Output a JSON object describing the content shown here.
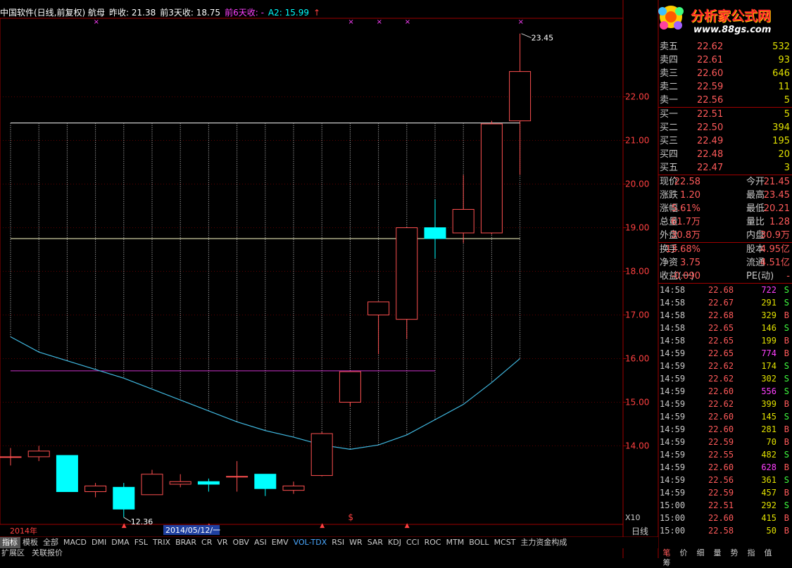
{
  "header": {
    "stock_name": "中国软件(日线,前复权) 航母",
    "prev_close": "昨收: 21.38",
    "prev3_close": "前3天收: 18.75",
    "prev6_close": "前6天收: -",
    "a2": "A2: 15.99",
    "colors": {
      "title": "#ffffff",
      "magenta": "#ff40ff",
      "cyan": "#00ffff"
    }
  },
  "logo": {
    "main": "分析家公式网",
    "url": "www.88gs.com"
  },
  "chart_data": {
    "type": "candlestick",
    "ylim": [
      12.2,
      23.8
    ],
    "y_ticks": [
      14.0,
      15.0,
      16.0,
      17.0,
      18.0,
      19.0,
      20.0,
      21.0,
      22.0
    ],
    "y_tick_labels": [
      "14.00",
      "15.00",
      "16.00",
      "17.00",
      "18.00",
      "19.00",
      "20.00",
      "21.00",
      "22.00"
    ],
    "candles": [
      {
        "o": 13.75,
        "c": 13.75,
        "h": 13.95,
        "l": 13.55
      },
      {
        "o": 13.75,
        "c": 13.88,
        "h": 14.0,
        "l": 13.65
      },
      {
        "o": 13.78,
        "c": 12.95,
        "h": 13.78,
        "l": 12.95
      },
      {
        "o": 12.95,
        "c": 13.08,
        "h": 13.15,
        "l": 12.82
      },
      {
        "o": 13.05,
        "c": 12.55,
        "h": 13.15,
        "l": 12.36
      },
      {
        "o": 12.88,
        "c": 13.35,
        "h": 13.45,
        "l": 12.88
      },
      {
        "o": 13.12,
        "c": 13.18,
        "h": 13.35,
        "l": 13.05
      },
      {
        "o": 13.18,
        "c": 13.12,
        "h": 13.25,
        "l": 12.95
      },
      {
        "o": 13.3,
        "c": 13.3,
        "h": 13.65,
        "l": 12.95
      },
      {
        "o": 13.35,
        "c": 13.02,
        "h": 13.35,
        "l": 12.85
      },
      {
        "o": 12.98,
        "c": 13.08,
        "h": 13.18,
        "l": 12.9
      },
      {
        "o": 13.32,
        "c": 14.28,
        "h": 14.32,
        "l": 13.3
      },
      {
        "o": 15.0,
        "c": 15.7,
        "h": 15.7,
        "l": 14.9
      },
      {
        "o": 17.0,
        "c": 17.3,
        "h": 17.3,
        "l": 16.1
      },
      {
        "o": 16.9,
        "c": 19.0,
        "h": 19.0,
        "l": 16.45
      },
      {
        "o": 19.0,
        "c": 18.75,
        "h": 19.65,
        "l": 18.3
      },
      {
        "o": 18.88,
        "c": 19.42,
        "h": 20.21,
        "l": 18.65
      },
      {
        "o": 18.88,
        "c": 21.38,
        "h": 21.45,
        "l": 18.85
      },
      {
        "o": 21.45,
        "c": 22.58,
        "h": 23.45,
        "l": 20.21
      }
    ],
    "up_color": "#ff5050",
    "down_color": "#00ffff",
    "h_lines": [
      {
        "value": 21.4,
        "color": "#ffffff",
        "from": 0,
        "to": 18
      },
      {
        "value": 18.75,
        "color": "#ffffcc",
        "from": 0,
        "to": 18
      },
      {
        "value": 15.72,
        "color": "#cc33cc",
        "from": 0,
        "to": 15
      }
    ],
    "curve": {
      "color": "#40b8e0",
      "values": [
        16.5,
        16.15,
        15.95,
        15.75,
        15.55,
        15.3,
        15.05,
        14.8,
        14.55,
        14.35,
        14.2,
        14.02,
        13.92,
        14.02,
        14.25,
        14.6,
        14.95,
        15.45,
        16.0
      ]
    },
    "max_label": "23.45",
    "min_label": "12.36",
    "zoom_label": "X10",
    "year_label": "2014年",
    "date_label": "2014/05/12/一",
    "signal_label": "$"
  },
  "quotes": {
    "sell": [
      {
        "label": "卖五",
        "price": "22.62",
        "vol": "532"
      },
      {
        "label": "卖四",
        "price": "22.61",
        "vol": "93"
      },
      {
        "label": "卖三",
        "price": "22.60",
        "vol": "646"
      },
      {
        "label": "卖二",
        "price": "22.59",
        "vol": "11"
      },
      {
        "label": "卖一",
        "price": "22.56",
        "vol": "5"
      }
    ],
    "buy": [
      {
        "label": "买一",
        "price": "22.51",
        "vol": "5"
      },
      {
        "label": "买二",
        "price": "22.50",
        "vol": "394"
      },
      {
        "label": "买三",
        "price": "22.49",
        "vol": "195"
      },
      {
        "label": "买四",
        "price": "22.48",
        "vol": "20"
      },
      {
        "label": "买五",
        "price": "22.47",
        "vol": "3"
      }
    ]
  },
  "stats": [
    {
      "a": "现价",
      "b": "22.58",
      "c": "今开",
      "d": "21.45"
    },
    {
      "a": "涨跌",
      "b": "1.20",
      "c": "最高",
      "d": "23.45"
    },
    {
      "a": "涨幅",
      "b": "5.61%",
      "c": "最低",
      "d": "20.21"
    },
    {
      "a": "总量",
      "b": "61.7万",
      "c": "量比",
      "d": "1.28"
    },
    {
      "a": "外盘",
      "b": "30.8万",
      "c": "内盘",
      "d": "30.9万"
    }
  ],
  "stats2": [
    {
      "a": "换手",
      "b": "13.68%",
      "c": "股本",
      "d": "4.95亿"
    },
    {
      "a": "净资",
      "b": "3.75",
      "c": "流通",
      "d": "4.51亿"
    },
    {
      "a": "收益(一)",
      "b": "-0.090",
      "c": "PE(动)",
      "d": "-"
    }
  ],
  "ticks": [
    {
      "t": "14:58",
      "p": "22.68",
      "v": "722",
      "s": "S",
      "vc": "#ff40ff"
    },
    {
      "t": "14:58",
      "p": "22.67",
      "v": "291",
      "s": "S",
      "vc": "#e0e000"
    },
    {
      "t": "14:58",
      "p": "22.68",
      "v": "329",
      "s": "B",
      "vc": "#e0e000"
    },
    {
      "t": "14:58",
      "p": "22.65",
      "v": "146",
      "s": "S",
      "vc": "#e0e000"
    },
    {
      "t": "14:58",
      "p": "22.65",
      "v": "199",
      "s": "B",
      "vc": "#e0e000"
    },
    {
      "t": "14:59",
      "p": "22.65",
      "v": "774",
      "s": "B",
      "vc": "#ff40ff"
    },
    {
      "t": "14:59",
      "p": "22.62",
      "v": "174",
      "s": "S",
      "vc": "#e0e000"
    },
    {
      "t": "14:59",
      "p": "22.62",
      "v": "302",
      "s": "S",
      "vc": "#e0e000"
    },
    {
      "t": "14:59",
      "p": "22.60",
      "v": "556",
      "s": "S",
      "vc": "#ff40ff"
    },
    {
      "t": "14:59",
      "p": "22.62",
      "v": "399",
      "s": "B",
      "vc": "#e0e000"
    },
    {
      "t": "14:59",
      "p": "22.60",
      "v": "145",
      "s": "S",
      "vc": "#e0e000"
    },
    {
      "t": "14:59",
      "p": "22.60",
      "v": "281",
      "s": "B",
      "vc": "#e0e000"
    },
    {
      "t": "14:59",
      "p": "22.59",
      "v": "70",
      "s": "B",
      "vc": "#e0e000"
    },
    {
      "t": "14:59",
      "p": "22.55",
      "v": "482",
      "s": "S",
      "vc": "#e0e000"
    },
    {
      "t": "14:59",
      "p": "22.60",
      "v": "628",
      "s": "B",
      "vc": "#ff40ff"
    },
    {
      "t": "14:59",
      "p": "22.56",
      "v": "361",
      "s": "S",
      "vc": "#e0e000"
    },
    {
      "t": "14:59",
      "p": "22.59",
      "v": "457",
      "s": "B",
      "vc": "#e0e000"
    },
    {
      "t": "15:00",
      "p": "22.51",
      "v": "292",
      "s": "S",
      "vc": "#e0e000"
    },
    {
      "t": "15:00",
      "p": "22.60",
      "v": "415",
      "s": "B",
      "vc": "#e0e000"
    },
    {
      "t": "15:00",
      "p": "22.58",
      "v": "50",
      "s": "B",
      "vc": "#e0e000"
    }
  ],
  "tabs": [
    "指标",
    "模板",
    "全部",
    "MACD",
    "DMI",
    "DMA",
    "FSL",
    "TRIX",
    "BRAR",
    "CR",
    "VR",
    "OBV",
    "ASI",
    "EMV",
    "VOL-TDX",
    "RSI",
    "WR",
    "SAR",
    "KDJ",
    "CCI",
    "ROC",
    "MTM",
    "BOLL",
    "MCST",
    "主力资金构成"
  ],
  "active_tab": "VOL-TDX",
  "bottom_links": [
    "扩展区",
    "关联报价"
  ],
  "right_tabs": [
    "笔",
    "价",
    "细",
    "量",
    "势",
    "指",
    "值",
    "筹"
  ],
  "day_box": {
    "label": "日线",
    "plus": "+",
    "minus": "-",
    "zero": "0"
  }
}
